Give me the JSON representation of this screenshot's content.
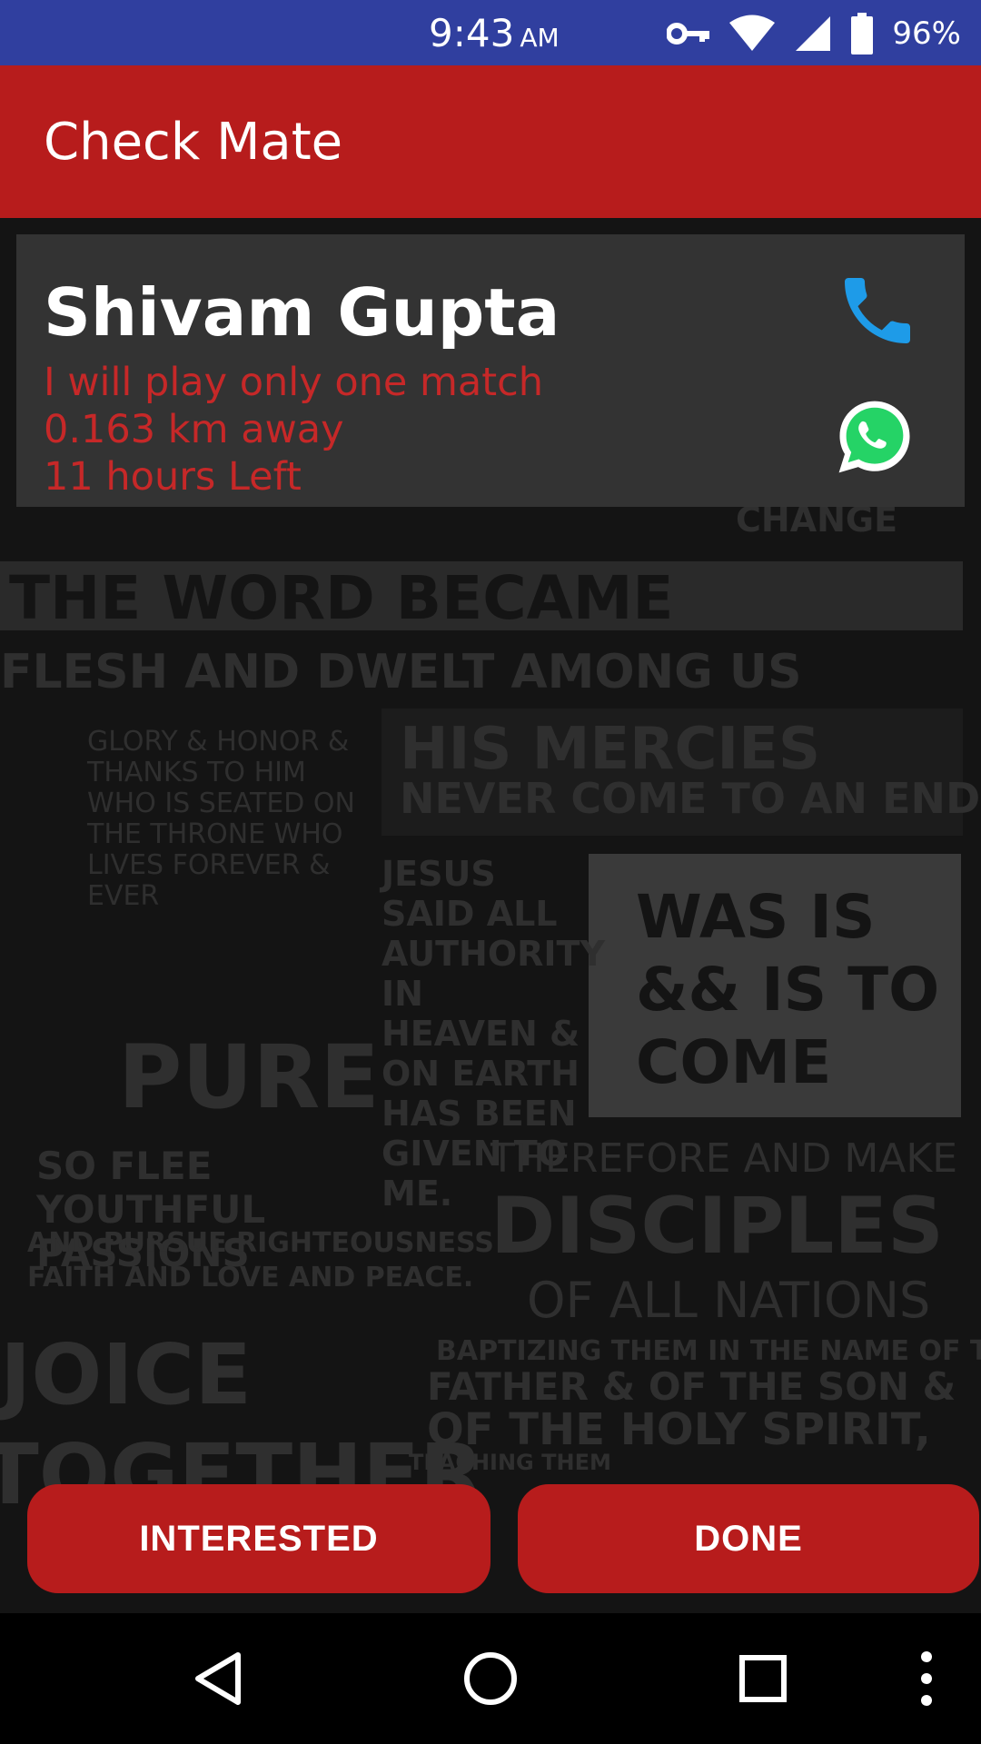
{
  "status_bar": {
    "time": "9:43",
    "ampm": "AM",
    "battery": "96%",
    "icons": [
      "key-icon",
      "wifi-icon",
      "signal-icon",
      "battery-icon"
    ],
    "background_color": "#303f9f"
  },
  "app_bar": {
    "title": "Check Mate",
    "background_color": "#b71c1c"
  },
  "card": {
    "name": "Shivam Gupta",
    "message": "I will play only one match",
    "distance": "0.163 km away",
    "time_left": "11 hours Left",
    "text_color": "#c62828",
    "actions": [
      "phone-icon",
      "whatsapp-icon"
    ]
  },
  "background_poster": {
    "lines": [
      "CHANGE",
      "THE WORD BECAME",
      "FLESH AND DWELT AMONG US",
      "HIS MERCIES",
      "NEVER COME TO AN END",
      "GLORY & HONOR & THANKS TO HIM WHO IS SEATED ON THE THRONE WHO LIVES FOREVER & EVER",
      "JESUS SAID ALL AUTHORITY IN HEAVEN & ON EARTH HAS BEEN GIVEN TO ME.",
      "WAS IS && IS TO COME",
      "PURE",
      "SO FLEE YOUTHFUL PASSIONS",
      "AND PURSUE RIGHTEOUSNESS FAITH AND LOVE AND PEACE.",
      "THEREFORE AND MAKE",
      "DISCIPLES",
      "OF ALL NATIONS",
      "BAPTIZING THEM IN THE NAME OF THE",
      "FATHER & OF THE SON &",
      "OF THE HOLY SPIRIT,",
      "TEACHING THEM",
      "JOICE",
      "TOGETHER"
    ]
  },
  "buttons": {
    "interested": "INTERESTED",
    "done": "DONE"
  },
  "nav_bar": {
    "items": [
      "back-icon",
      "home-icon",
      "recents-icon",
      "more-icon"
    ]
  }
}
